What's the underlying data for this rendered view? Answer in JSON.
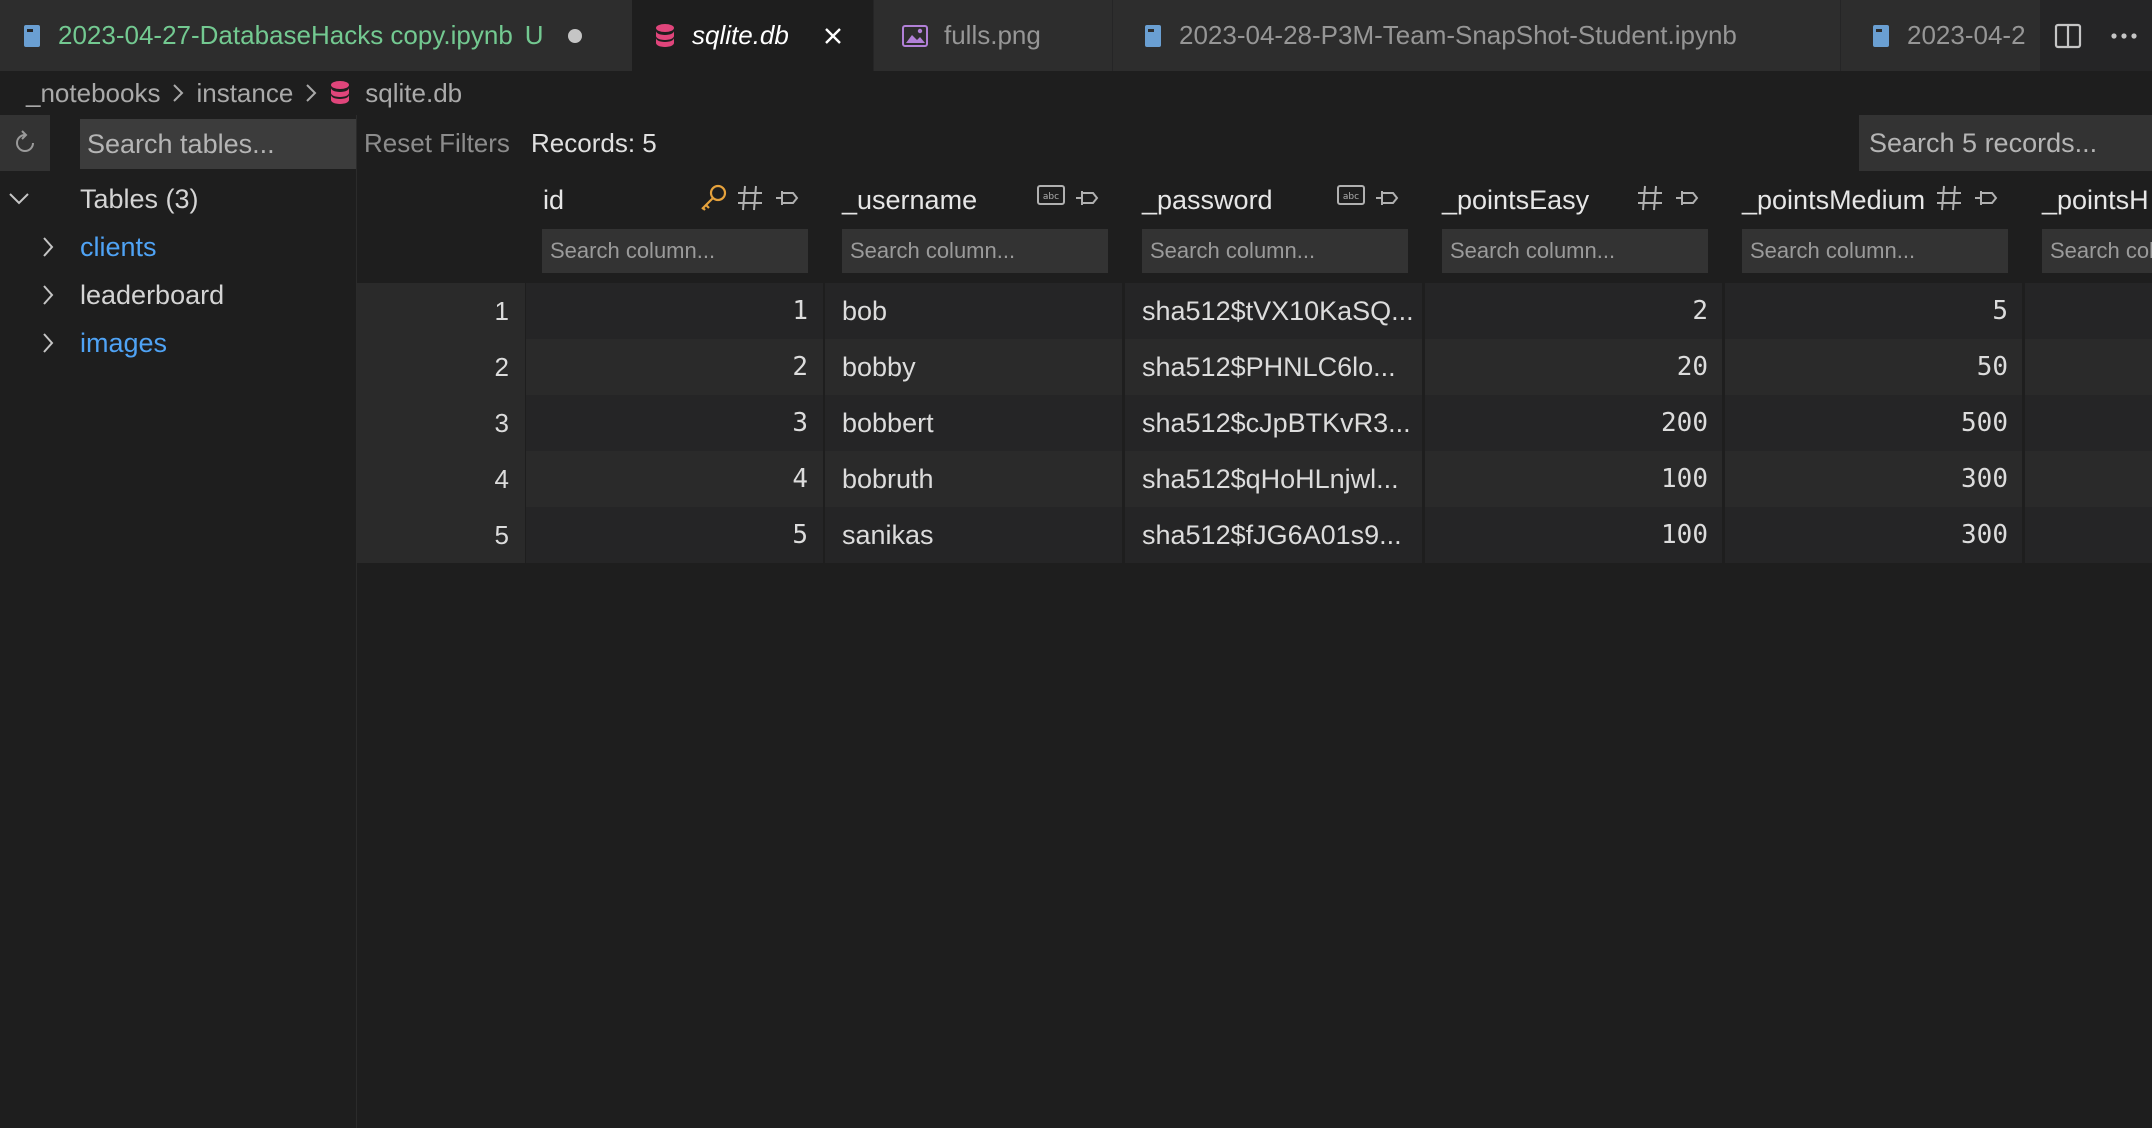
{
  "tabs": [
    {
      "label": "2023-04-27-DatabaseHacks copy.ipynb",
      "badge": "U",
      "icon": "notebook-icon",
      "state": "modified-unsaved"
    },
    {
      "label": "sqlite.db",
      "icon": "database-icon",
      "state": "active"
    },
    {
      "label": "fulls.png",
      "icon": "image-icon",
      "state": "inactive"
    },
    {
      "label": "2023-04-28-P3M-Team-SnapShot-Student.ipynb",
      "icon": "notebook-icon",
      "state": "inactive"
    },
    {
      "label": "2023-04-2",
      "icon": "notebook-icon",
      "state": "inactive"
    }
  ],
  "tab_actions": [
    "split-editor-icon",
    "more-actions-icon"
  ],
  "breadcrumb": [
    "_notebooks",
    "instance",
    "sqlite.db"
  ],
  "sidebar": {
    "search_placeholder": "Search tables...",
    "tables_header": "Tables (3)",
    "tables": [
      {
        "name": "clients",
        "style": "link"
      },
      {
        "name": "leaderboard",
        "style": "plain"
      },
      {
        "name": "images",
        "style": "link"
      }
    ]
  },
  "toolbar": {
    "reset_filters": "Reset Filters",
    "records": "Records: 5",
    "search_placeholder": "Search 5 records..."
  },
  "grid": {
    "filter_placeholder": "Search column...",
    "columns": [
      {
        "name": "id",
        "icons": [
          "key-icon",
          "number-type-icon",
          "pin-icon"
        ]
      },
      {
        "name": "_username",
        "icons": [
          "text-type-icon",
          "pin-icon"
        ]
      },
      {
        "name": "_password",
        "icons": [
          "text-type-icon",
          "pin-icon"
        ]
      },
      {
        "name": "_pointsEasy",
        "icons": [
          "number-type-icon",
          "pin-icon"
        ]
      },
      {
        "name": "_pointsMedium",
        "icons": [
          "number-type-icon",
          "pin-icon"
        ]
      },
      {
        "name": "_pointsH",
        "icons": []
      }
    ],
    "rows": [
      {
        "num": "1",
        "id": "1",
        "username": "bob",
        "password": "sha512$tVX10KaSQ...",
        "pointsEasy": "2",
        "pointsMedium": "5"
      },
      {
        "num": "2",
        "id": "2",
        "username": "bobby",
        "password": "sha512$PHNLC6lo...",
        "pointsEasy": "20",
        "pointsMedium": "50"
      },
      {
        "num": "3",
        "id": "3",
        "username": "bobbert",
        "password": "sha512$cJpBTKvR3...",
        "pointsEasy": "200",
        "pointsMedium": "500"
      },
      {
        "num": "4",
        "id": "4",
        "username": "bobruth",
        "password": "sha512$qHoHLnjwl...",
        "pointsEasy": "100",
        "pointsMedium": "300"
      },
      {
        "num": "5",
        "id": "5",
        "username": "sanikas",
        "password": "sha512$fJG6A01s9...",
        "pointsEasy": "100",
        "pointsMedium": "300"
      }
    ]
  },
  "colors": {
    "editor_bg": "#1e1e1e",
    "tab_bg": "#2d2d2d",
    "modified_green": "#73c991",
    "link_blue": "#4fa3f5",
    "db_icon_pink": "#e0457b",
    "key_orange": "#e6a23c",
    "image_icon_purple": "#b180d7",
    "notebook_icon_blue": "#6a9fd2"
  }
}
